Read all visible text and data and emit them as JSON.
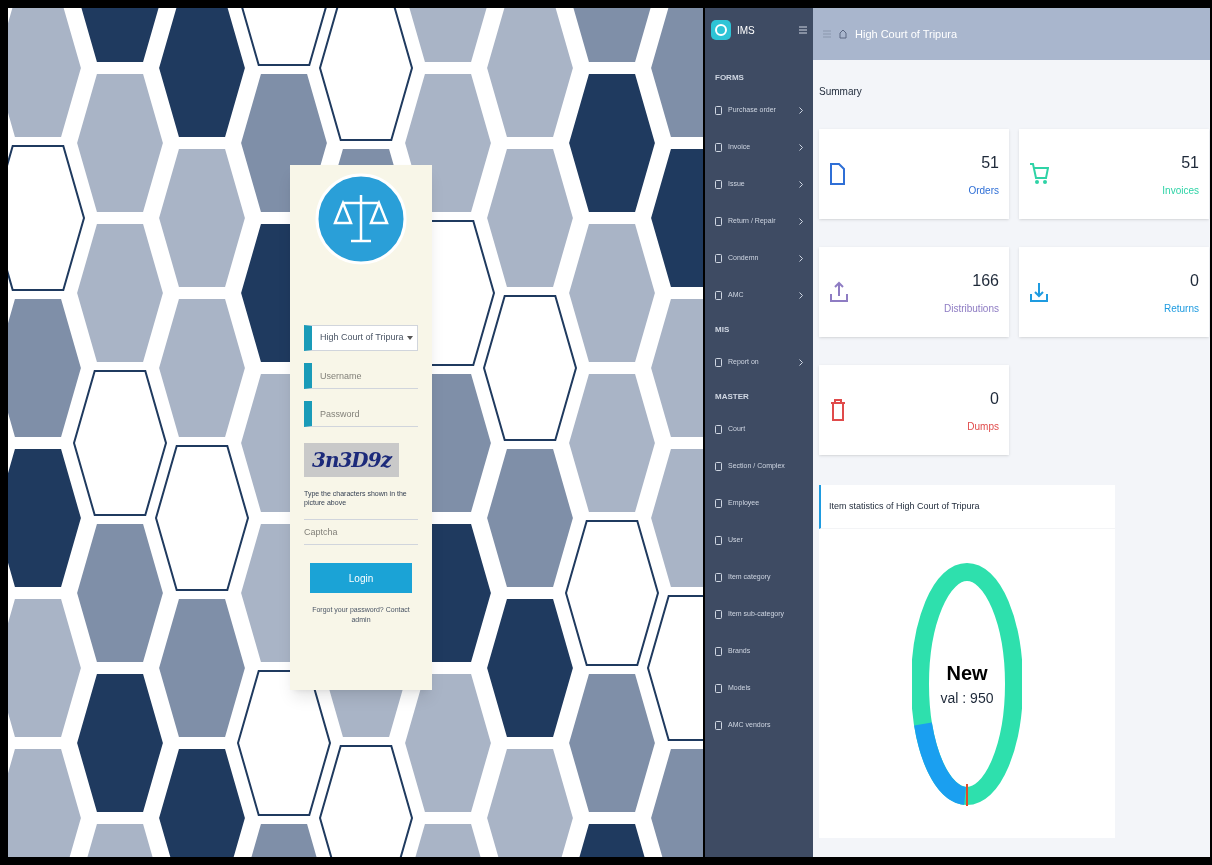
{
  "login": {
    "court_select": "High Court of Tripura",
    "username_placeholder": "Username",
    "password_placeholder": "Password",
    "captcha": "3n3D9z",
    "captcha_hint": "Type the characters shown in the picture above",
    "captcha_placeholder": "Captcha",
    "login_button": "Login",
    "footer": "Forgot your password? Contact admin"
  },
  "dashboard": {
    "app_name": "IMS",
    "header_title": "High Court of Tripura",
    "sidebar": [
      {
        "kind": "section",
        "label": "FORMS"
      },
      {
        "kind": "item",
        "label": "Purchase order",
        "submenu": true
      },
      {
        "kind": "item",
        "label": "Invoice",
        "submenu": true
      },
      {
        "kind": "item",
        "label": "Issue",
        "submenu": true
      },
      {
        "kind": "item",
        "label": "Return / Repair",
        "submenu": true
      },
      {
        "kind": "item",
        "label": "Condemn",
        "submenu": true
      },
      {
        "kind": "item",
        "label": "AMC",
        "submenu": true
      },
      {
        "kind": "section",
        "label": "MIS"
      },
      {
        "kind": "item",
        "label": "Report on",
        "submenu": true
      },
      {
        "kind": "section",
        "label": "MASTER"
      },
      {
        "kind": "item",
        "label": "Court",
        "submenu": false
      },
      {
        "kind": "item",
        "label": "Section / Complex",
        "submenu": false
      },
      {
        "kind": "item",
        "label": "Employee",
        "submenu": false
      },
      {
        "kind": "item",
        "label": "User",
        "submenu": false
      },
      {
        "kind": "item",
        "label": "Item category",
        "submenu": false
      },
      {
        "kind": "item",
        "label": "Item sub-category",
        "submenu": false
      },
      {
        "kind": "item",
        "label": "Brands",
        "submenu": false
      },
      {
        "kind": "item",
        "label": "Models",
        "submenu": false
      },
      {
        "kind": "item",
        "label": "AMC vendors",
        "submenu": false
      }
    ],
    "summary_title": "Summary",
    "cards": [
      {
        "kind": "document",
        "value": "51",
        "label": "Orders",
        "color": "#2f6fd6"
      },
      {
        "kind": "cart",
        "value": "51",
        "label": "Invoices",
        "color": "#2ed3a6"
      },
      {
        "kind": "upload",
        "value": "166",
        "label": "Distributions",
        "color": "#8e7cc3"
      },
      {
        "kind": "download",
        "value": "0",
        "label": "Returns",
        "color": "#1e9be0"
      },
      {
        "kind": "trash",
        "value": "0",
        "label": "Dumps",
        "color": "#e04b4b"
      }
    ],
    "chart_title": "Item statistics of High Court of Tripura",
    "chart_center_label": "New",
    "chart_center_value": "val : 950"
  }
}
